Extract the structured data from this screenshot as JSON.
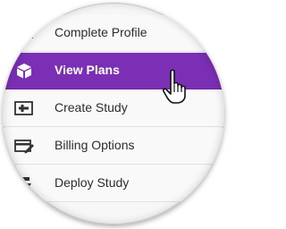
{
  "menu": {
    "items": [
      {
        "label": "Complete Profile",
        "icon": "profile-card-icon"
      },
      {
        "label": "View Plans",
        "icon": "cube-icon",
        "active": true
      },
      {
        "label": "Create Study",
        "icon": "add-box-icon"
      },
      {
        "label": "Billing Options",
        "icon": "edit-card-icon"
      },
      {
        "label": "Deploy Study",
        "icon": "deploy-icon"
      }
    ]
  },
  "colors": {
    "accent": "#7a2fb4",
    "background": "#f9f9f9",
    "text": "#2c2c2c"
  },
  "cursor": "hand-pointer-icon"
}
